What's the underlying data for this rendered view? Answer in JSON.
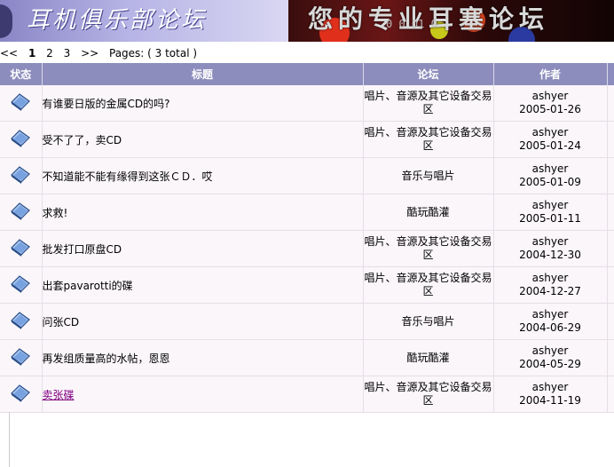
{
  "banner": {
    "forum_name": "耳机俱乐部论坛",
    "slogan": "您的专业耳塞论坛",
    "digits": "0 0 01 0"
  },
  "pager": {
    "prev": "<<",
    "pages": [
      "1",
      "2",
      "3"
    ],
    "current": "1",
    "next": ">>",
    "summary": "Pages: ( 3 total )"
  },
  "table": {
    "headers": {
      "status": "状态",
      "title": "标题",
      "forum": "论坛",
      "author": "作者"
    },
    "rows": [
      {
        "title": "有谁要日版的金属CD的吗?",
        "forum": "唱片、音源及其它设备交易区",
        "author": "ashyer",
        "date": "2005-01-26"
      },
      {
        "title": "受不了了，卖CD",
        "forum": "唱片、音源及其它设备交易区",
        "author": "ashyer",
        "date": "2005-01-24"
      },
      {
        "title": "不知道能不能有缘得到这张ＣＤ．哎",
        "forum": "音乐与唱片",
        "author": "ashyer",
        "date": "2005-01-09"
      },
      {
        "title": "求救!",
        "forum": "酷玩酷灌",
        "author": "ashyer",
        "date": "2005-01-11"
      },
      {
        "title": "批发打口原盘CD",
        "forum": "唱片、音源及其它设备交易区",
        "author": "ashyer",
        "date": "2004-12-30"
      },
      {
        "title": "出套pavarotti的碟",
        "forum": "唱片、音源及其它设备交易区",
        "author": "ashyer",
        "date": "2004-12-27"
      },
      {
        "title": "问张CD",
        "forum": "音乐与唱片",
        "author": "ashyer",
        "date": "2004-06-29"
      },
      {
        "title": "再发组质量高的水帖，恩恩",
        "forum": "酷玩酷灌",
        "author": "ashyer",
        "date": "2004-05-29"
      },
      {
        "title": "卖张碟",
        "forum": "唱片、音源及其它设备交易区",
        "author": "ashyer",
        "date": "2004-11-19"
      }
    ]
  },
  "icons": {
    "status": "folder-icon"
  },
  "colors": {
    "header_bg": "#8d8dbd",
    "row_bg": "#faf6fa",
    "visited_link": "#800080"
  }
}
